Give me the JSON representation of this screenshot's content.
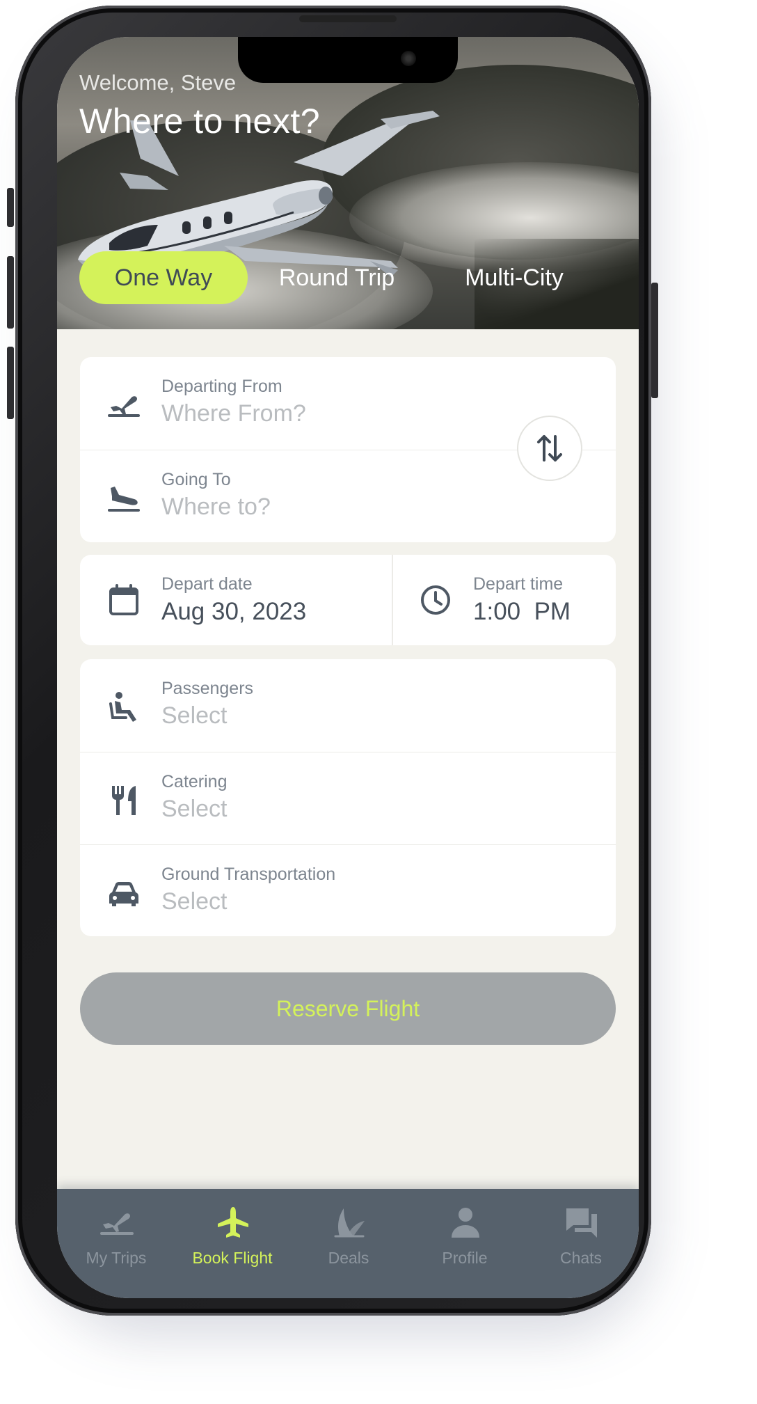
{
  "header": {
    "welcome": "Welcome, Steve",
    "headline": "Where to next?"
  },
  "trip_tabs": [
    {
      "label": "One Way",
      "active": true
    },
    {
      "label": "Round Trip",
      "active": false
    },
    {
      "label": "Multi-City",
      "active": false
    }
  ],
  "route": {
    "from": {
      "label": "Departing From",
      "placeholder": "Where From?",
      "icon": "takeoff-icon"
    },
    "to": {
      "label": "Going To",
      "placeholder": "Where to?",
      "icon": "landing-icon"
    },
    "swap_icon": "swap-vertical-icon"
  },
  "schedule": {
    "date": {
      "label": "Depart date",
      "value": "Aug 30, 2023",
      "icon": "calendar-icon"
    },
    "time": {
      "label": "Depart time",
      "value": "1:00  PM",
      "icon": "clock-icon"
    }
  },
  "options": [
    {
      "label": "Passengers",
      "placeholder": "Select",
      "icon": "seat-icon"
    },
    {
      "label": "Catering",
      "placeholder": "Select",
      "icon": "utensils-icon"
    },
    {
      "label": "Ground Transportation",
      "placeholder": "Select",
      "icon": "car-icon"
    }
  ],
  "reserve_label": "Reserve Flight",
  "bottom_nav": [
    {
      "label": "My Trips",
      "icon": "takeoff-icon",
      "active": false
    },
    {
      "label": "Book Flight",
      "icon": "airplane-icon",
      "active": true
    },
    {
      "label": "Deals",
      "icon": "deals-leaf-icon",
      "active": false
    },
    {
      "label": "Profile",
      "icon": "person-icon",
      "active": false
    },
    {
      "label": "Chats",
      "icon": "chat-icon",
      "active": false
    }
  ],
  "colors": {
    "accent": "#d4f25a",
    "background": "#f3f2ec",
    "nav_background": "#56616c",
    "text_dark": "#47505b",
    "text_muted": "#7d858f",
    "placeholder": "#b9bcbf",
    "button_disabled": "#a2a6a8"
  }
}
